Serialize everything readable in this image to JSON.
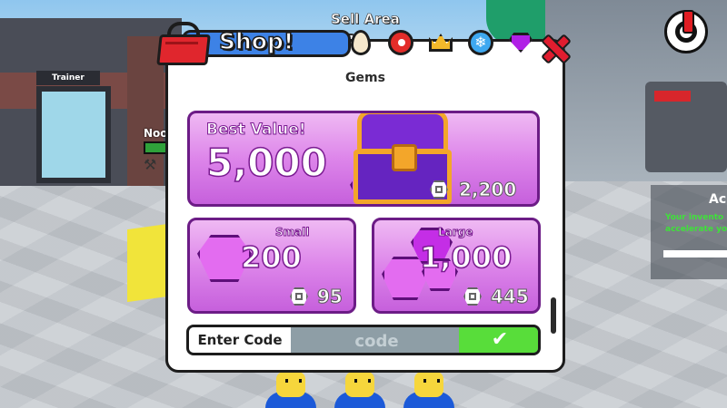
{
  "world": {
    "trainer_sign": "Trainer",
    "player_name": "Noo",
    "side_panel_title": "Ac",
    "side_panel_line1": "Your invento",
    "side_panel_line2": "accelerate you"
  },
  "hud": {
    "sell_area_label": "Sell Area",
    "sell_progress": 0.85,
    "power_icon": "power-icon"
  },
  "shop": {
    "title": "Shop!",
    "section_title": "Gems",
    "tabs": [
      {
        "icon": "egg-icon"
      },
      {
        "icon": "clock-icon"
      },
      {
        "icon": "crown-icon"
      },
      {
        "icon": "snowflake-icon"
      },
      {
        "icon": "gem-icon"
      }
    ],
    "best_value": {
      "label": "Best Value!",
      "amount": "5,000",
      "price": "2,200"
    },
    "small": {
      "label": "Small",
      "amount": "200",
      "price": "95"
    },
    "large": {
      "label": "Large",
      "amount": "1,000",
      "price": "445"
    },
    "code": {
      "label": "Enter Code",
      "placeholder": "code",
      "confirm_icon": "✔"
    }
  },
  "colors": {
    "gem_purple": "#c42ee6",
    "card_border": "#6c1c86",
    "confirm_green": "#58dd3a",
    "close_red": "#e01d2f"
  }
}
